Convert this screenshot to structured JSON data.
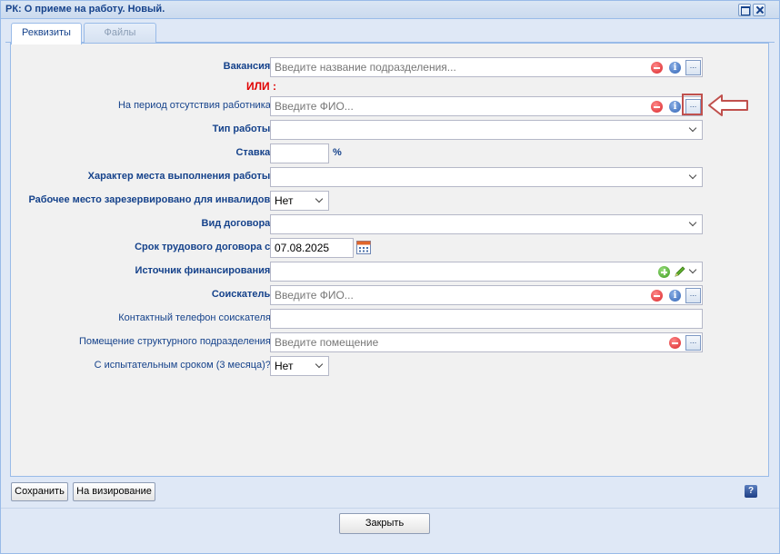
{
  "window": {
    "title": "РК: О приеме на работу. Новый."
  },
  "tabs": [
    {
      "label": "Реквизиты",
      "active": true
    },
    {
      "label": "Файлы",
      "active": false
    }
  ],
  "form": {
    "vacancy": {
      "label": "Вакансия :",
      "placeholder": "Введите название подразделения..."
    },
    "or_label": "ИЛИ :",
    "absent_employee": {
      "label": "На период отсутствия работника :",
      "placeholder": "Введите ФИО..."
    },
    "work_type": {
      "label": "Тип работы :",
      "value": ""
    },
    "rate": {
      "label": "Ставка :",
      "value": "",
      "unit": "%"
    },
    "work_place_character": {
      "label": "Характер места выполнения работы :",
      "value": ""
    },
    "reserved_for_disabled": {
      "label": "Рабочее место зарезервировано для инвалидов :",
      "value": "Нет"
    },
    "contract_type": {
      "label": "Вид договора :",
      "value": ""
    },
    "contract_term_from": {
      "label": "Срок трудового договора с :",
      "value": "07.08.2025"
    },
    "funding_source": {
      "label": "Источник финансирования :",
      "value": ""
    },
    "applicant": {
      "label": "Соискатель :",
      "placeholder": "Введите ФИО..."
    },
    "applicant_phone": {
      "label": "Контактный телефон соискателя :",
      "value": ""
    },
    "structural_unit_room": {
      "label": "Помещение структурного подразделения :",
      "placeholder": "Введите помещение"
    },
    "probation": {
      "label": "С испытательным сроком (3 месяца)? :",
      "value": "Нет"
    }
  },
  "actions": {
    "save_label": "Сохранить",
    "submit_label": "На визирование",
    "help_label": "?",
    "close_label": "Закрыть"
  },
  "icons": {
    "info_glyph": "i",
    "ellipsis_glyph": "...",
    "accent": "#15428b",
    "annotation_color": "#c0504d"
  }
}
